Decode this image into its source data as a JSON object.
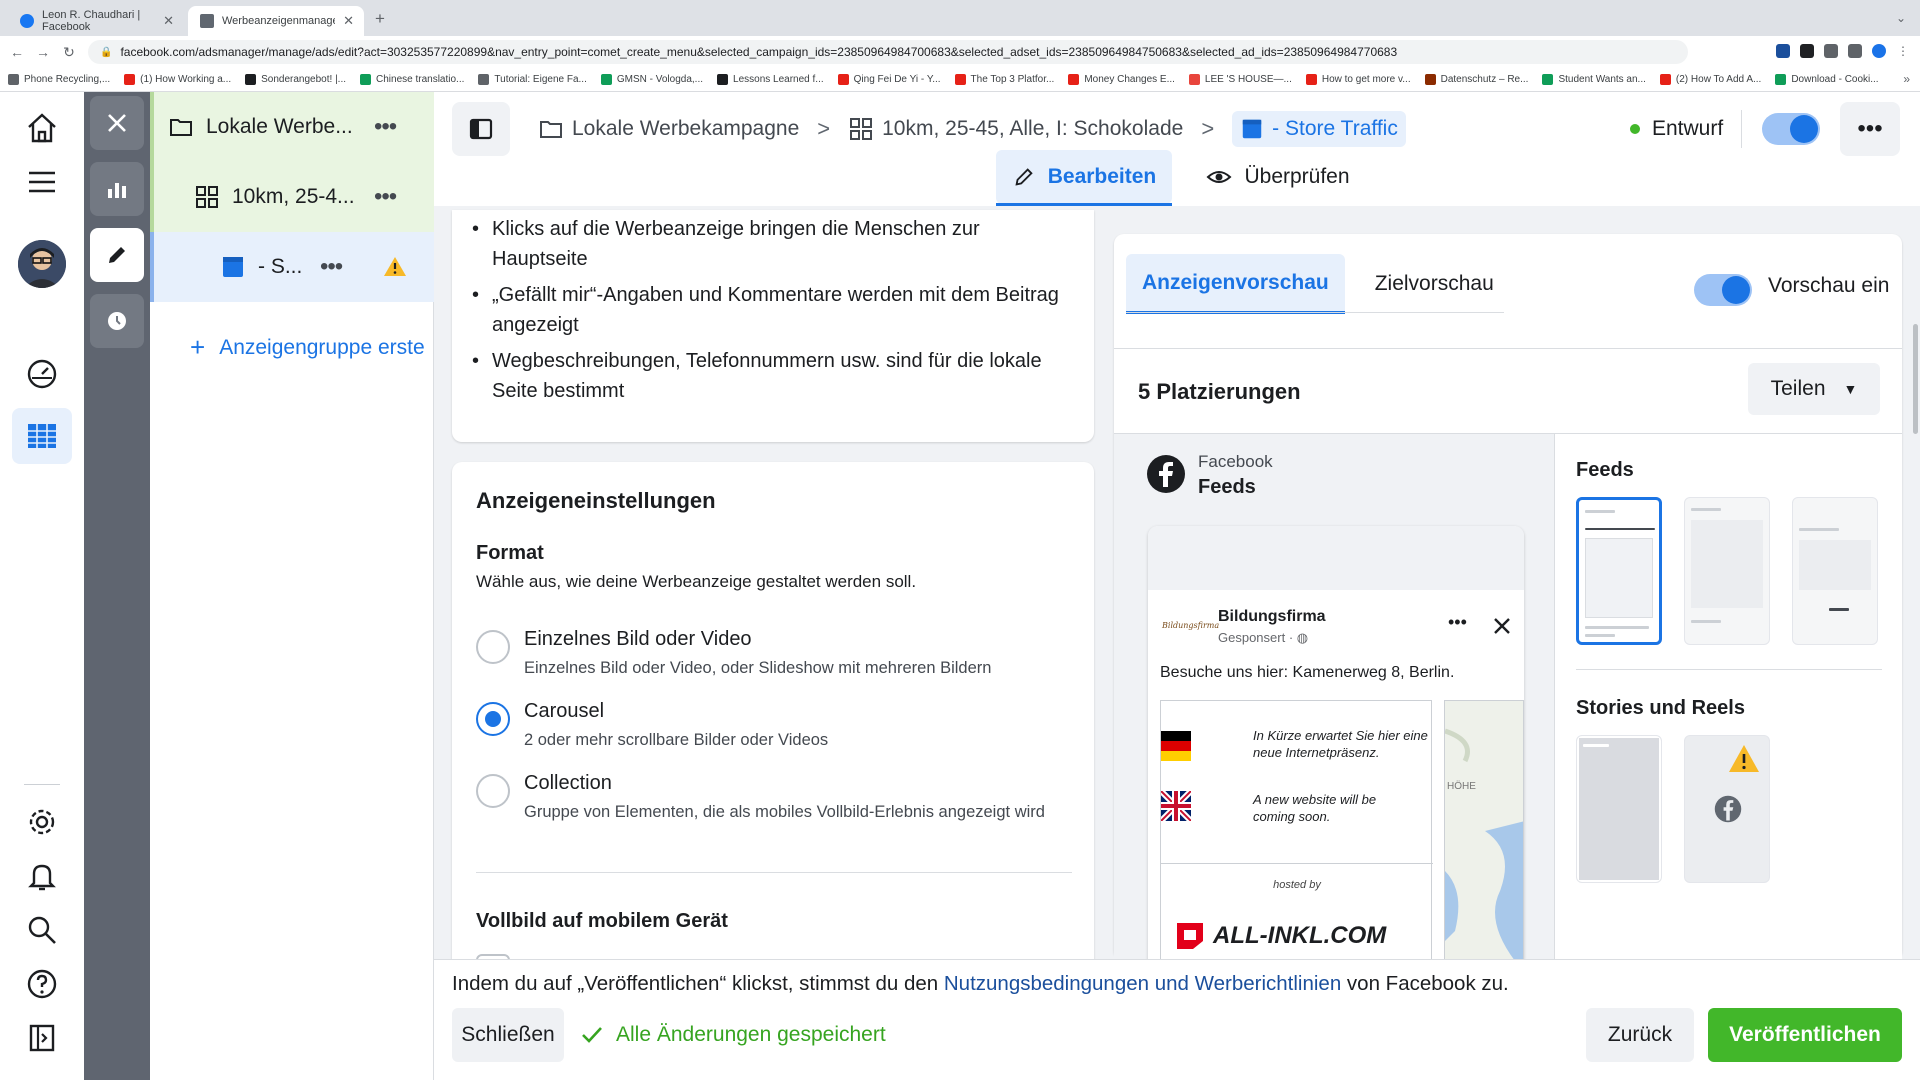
{
  "browser": {
    "tabs": [
      {
        "title": "Leon R. Chaudhari | Facebook",
        "active": false
      },
      {
        "title": "Werbeanzeigenmanager - Wer",
        "active": true
      }
    ],
    "url": "facebook.com/adsmanager/manage/ads/edit?act=303253577220899&nav_entry_point=comet_create_menu&selected_campaign_ids=23850964984700683&selected_adset_ids=23850964984750683&selected_ad_ids=23850964984770683",
    "bookmarks": [
      "Phone Recycling,...",
      "(1) How Working a...",
      "Sonderangebot! |...",
      "Chinese translatio...",
      "Tutorial: Eigene Fa...",
      "GMSN - Vologda,...",
      "Lessons Learned f...",
      "Qing Fei De Yi - Y...",
      "The Top 3 Platfor...",
      "Money Changes E...",
      "LEE 'S HOUSE—...",
      "How to get more v...",
      "Datenschutz – Re...",
      "Student Wants an...",
      "(2) How To Add A...",
      "Download - Cooki..."
    ]
  },
  "tree": {
    "campaign": "Lokale Werbe...",
    "adset": "10km, 25-4...",
    "ad": "- S...",
    "add_adset": "Anzeigengruppe erste"
  },
  "header": {
    "breadcrumbs": [
      "Lokale Werbekampagne",
      "10km, 25-45, Alle, I: Schokolade",
      "- Store Traffic"
    ],
    "status": "Entwurf",
    "mode_edit": "Bearbeiten",
    "mode_review": "Überprüfen"
  },
  "info_bullets": [
    "Klicks auf die Werbeanzeige bringen die Menschen zur Hauptseite",
    "„Gefällt mir“-Angaben und Kommentare werden mit dem Beitrag angezeigt",
    "Wegbeschreibungen, Telefonnummern usw. sind für die lokale Seite bestimmt"
  ],
  "ad_settings": {
    "title": "Anzeigeneinstellungen",
    "format_label": "Format",
    "format_desc": "Wähle aus, wie deine Werbeanzeige gestaltet werden soll.",
    "options": [
      {
        "title": "Einzelnes Bild oder Video",
        "sub": "Einzelnes Bild oder Video, oder Slideshow mit mehreren Bildern",
        "selected": false
      },
      {
        "title": "Carousel",
        "sub": "2 oder mehr scrollbare Bilder oder Videos",
        "selected": true
      },
      {
        "title": "Collection",
        "sub": "Gruppe von Elementen, die als mobiles Vollbild-Erlebnis angezeigt wird",
        "selected": false
      }
    ],
    "fullscreen_label": "Vollbild auf mobilem Gerät"
  },
  "preview": {
    "tab_ad": "Anzeigenvorschau",
    "tab_target": "Zielvorschau",
    "toggle_label": "Vorschau ein",
    "placements_title": "5 Platzierungen",
    "share": "Teilen",
    "platform": "Facebook",
    "placement": "Feeds",
    "feeds_heading": "Feeds",
    "stories_heading": "Stories und Reels",
    "post": {
      "page_name": "Bildungsfirma",
      "sponsored": "Gesponsert ·",
      "logo_text": "Bildungsfirma",
      "text": "Besuche uns hier: Kamenerweg 8, Berlin.",
      "card_de": "In Kürze erwartet Sie hier eine neue Internetpräsenz.",
      "card_en": "A new website will be coming soon.",
      "hosted_by": "hosted by",
      "host_brand": "ALL-INKL.COM",
      "map_label": "HÖHE"
    }
  },
  "footer": {
    "terms_pre": "Indem du auf „Veröffentlichen“ klickst, stimmst du den ",
    "terms_link": "Nutzungsbedingungen und Werberichtlinien",
    "terms_post": " von Facebook zu.",
    "close": "Schließen",
    "saved": "Alle Änderungen gespeichert",
    "back": "Zurück",
    "publish": "Veröffentlichen"
  },
  "colors": {
    "accent": "#1b74e4",
    "publish": "#42b72a",
    "draft": "#42b72a",
    "warning": "#f7b928"
  }
}
